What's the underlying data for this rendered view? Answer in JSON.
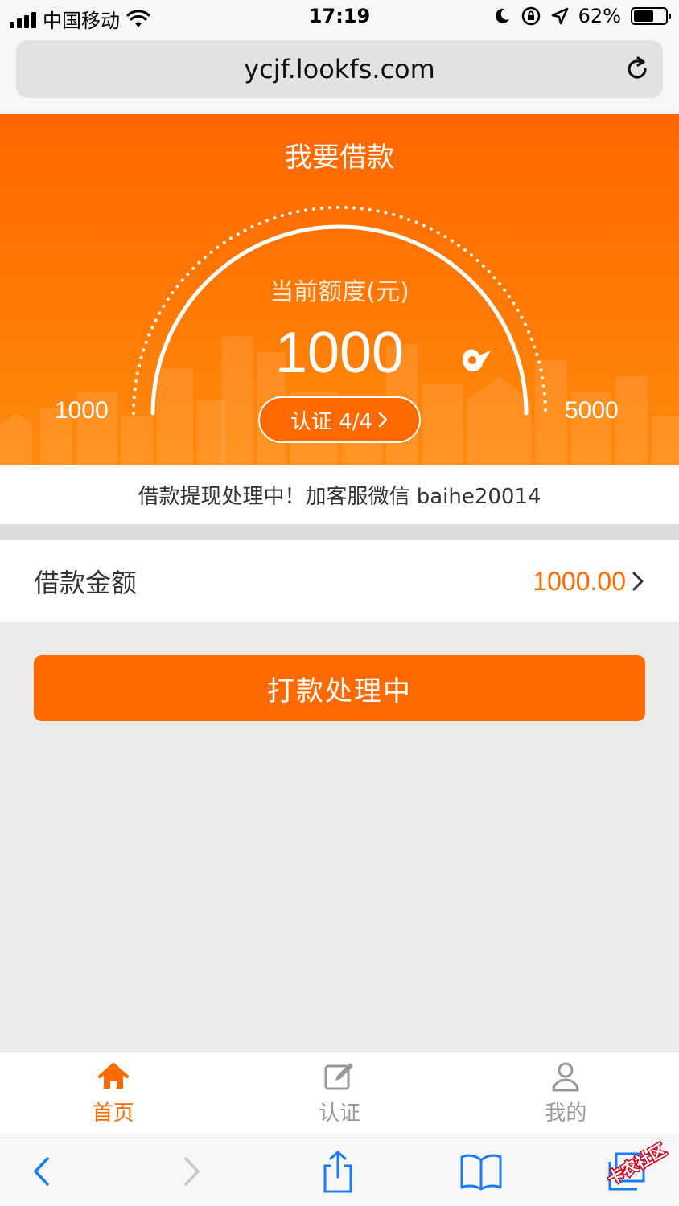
{
  "status_bar": {
    "carrier": "中国移动",
    "time": "17:19",
    "battery": "62%",
    "battery_level": 0.62
  },
  "browser": {
    "url": "ycjf.lookfs.com"
  },
  "hero": {
    "title": "我要借款",
    "limit_label": "当前额度(元)",
    "limit_value": "1000",
    "min": "1000",
    "max": "5000",
    "auth_button": "认证 4/4"
  },
  "notice": "借款提现处理中！加客服微信 baihe20014",
  "loan": {
    "amount_label": "借款金额",
    "amount_value": "1000.00"
  },
  "main_button": "打款处理中",
  "tabs": [
    {
      "label": "首页",
      "icon": "home-icon",
      "active": true
    },
    {
      "label": "认证",
      "icon": "edit-icon",
      "active": false
    },
    {
      "label": "我的",
      "icon": "user-icon",
      "active": false
    }
  ],
  "watermark": "卡农社区",
  "colors": {
    "accent": "#ff6a00",
    "safari_blue": "#1a7cf5"
  }
}
